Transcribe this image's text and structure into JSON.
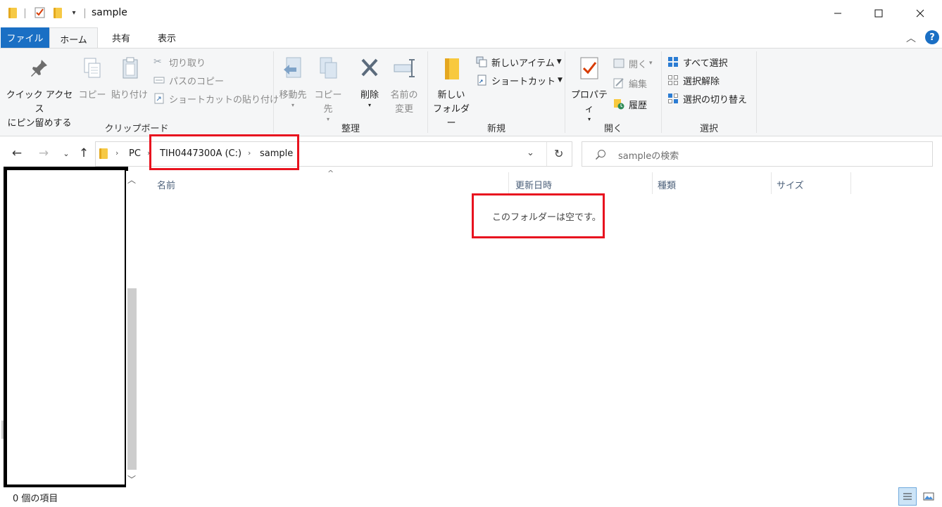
{
  "window": {
    "title": "sample",
    "minimize_icon": "minimize-icon",
    "maximize_icon": "maximize-icon",
    "close_icon": "close-icon"
  },
  "tabs": [
    {
      "label": "ファイル"
    },
    {
      "label": "ホーム"
    },
    {
      "label": "共有"
    },
    {
      "label": "表示"
    }
  ],
  "ribbon": {
    "clipboard": {
      "label": "クリップボード",
      "pin_line1": "クイック アクセス",
      "pin_line2": "にピン留めする",
      "copy": "コピー",
      "paste": "貼り付け",
      "cut": "切り取り",
      "copy_path": "パスのコピー",
      "paste_shortcut": "ショートカットの貼り付け"
    },
    "organize": {
      "label": "整理",
      "move_to": "移動先",
      "copy_to": "コピー先",
      "delete": "削除",
      "rename_line1": "名前の",
      "rename_line2": "変更"
    },
    "new": {
      "label": "新規",
      "new_folder_line1": "新しい",
      "new_folder_line2": "フォルダー",
      "new_item": "新しいアイテム",
      "shortcut": "ショートカット"
    },
    "open": {
      "label": "開く",
      "properties": "プロパティ",
      "open": "開く",
      "edit": "編集",
      "history": "履歴"
    },
    "select": {
      "label": "選択",
      "select_all": "すべて選択",
      "select_none": "選択解除",
      "invert": "選択の切り替え"
    }
  },
  "address": {
    "crumbs": [
      "PC",
      "TIH0447300A (C:)",
      "sample"
    ]
  },
  "search": {
    "placeholder": "sampleの検索"
  },
  "columns": [
    "名前",
    "更新日時",
    "種類",
    "サイズ"
  ],
  "empty_message": "このフォルダーは空です。",
  "status": {
    "item_count": "0 個の項目"
  },
  "colors": {
    "file_tab": "#1a6fc4",
    "annotation_red": "#e8131f"
  }
}
